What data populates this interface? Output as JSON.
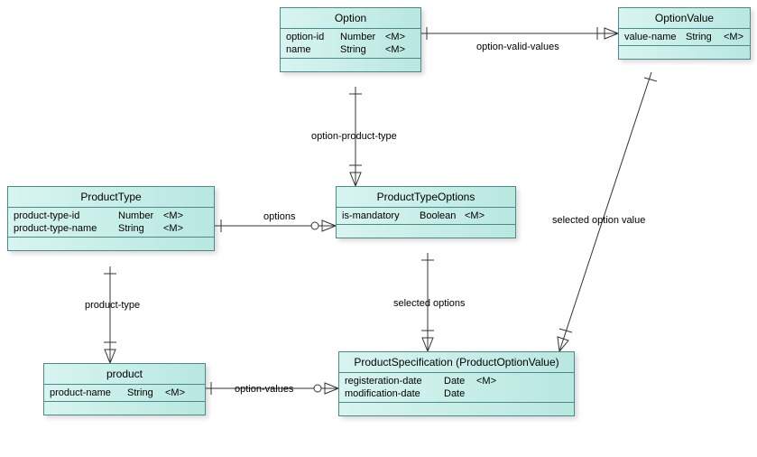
{
  "entities": {
    "option": {
      "title": "Option",
      "attrs": [
        {
          "name": "option-id",
          "type": "Number",
          "mandatory": "<M>"
        },
        {
          "name": "name",
          "type": "String",
          "mandatory": "<M>"
        }
      ]
    },
    "optionValue": {
      "title": "OptionValue",
      "attrs": [
        {
          "name": "value-name",
          "type": "String",
          "mandatory": "<M>"
        }
      ]
    },
    "productType": {
      "title": "ProductType",
      "attrs": [
        {
          "name": "product-type-id",
          "type": "Number",
          "mandatory": "<M>"
        },
        {
          "name": "product-type-name",
          "type": "String",
          "mandatory": "<M>"
        }
      ]
    },
    "productTypeOptions": {
      "title": "ProductTypeOptions",
      "attrs": [
        {
          "name": "is-mandatory",
          "type": "Boolean",
          "mandatory": "<M>"
        }
      ]
    },
    "product": {
      "title": "product",
      "attrs": [
        {
          "name": "product-name",
          "type": "String",
          "mandatory": "<M>"
        }
      ]
    },
    "productSpec": {
      "title": "ProductSpecification (ProductOptionValue)",
      "attrs": [
        {
          "name": "registeration-date",
          "type": "Date",
          "mandatory": "<M>"
        },
        {
          "name": "modification-date",
          "type": "Date",
          "mandatory": ""
        }
      ]
    }
  },
  "relations": {
    "optionValidValues": "option-valid-values",
    "optionProductType": "option-product-type",
    "options": "options",
    "productTypeRel": "product-type",
    "selectedOptions": "selected options",
    "optionValues": "option-values",
    "selectedOptionValue": "selected option value"
  }
}
